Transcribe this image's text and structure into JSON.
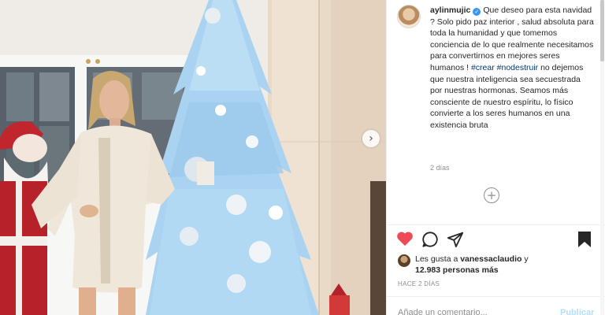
{
  "post": {
    "username": "aylinmujic",
    "verified_icon": "verified-badge-icon",
    "caption_main": "Que deseo para esta navidad ? Solo pido paz interior , salud absoluta para toda la humanidad y que tomemos conciencia de lo que realmente necesitamos para convertirnos en mejores seres humanos ! ",
    "hashtag_1": "#crear",
    "hashtag_2": "#nodestruir",
    "caption_end": " no dejemos que nuestra inteligencia sea secuestrada por nuestras hormonas. Seamos más consciente de nuestro espíritu, lo físico convierte a los seres humanos en una existencia bruta",
    "time_ago": "2 días",
    "add_comment_glyph": "+"
  },
  "actions": {
    "like_icon": "heart-icon",
    "comment_icon": "comment-icon",
    "share_icon": "share-icon",
    "save_icon": "bookmark-icon"
  },
  "likes": {
    "prefix": "Les gusta a ",
    "user": "vanessaclaudio",
    "middle": " y",
    "count": "12.983 personas más"
  },
  "date_label": "HACE 2 DÍAS",
  "comment": {
    "placeholder": "Añade un comentario...",
    "publish_label": "Publicar"
  },
  "carousel": {
    "next_glyph": "›"
  },
  "colors": {
    "heart": "#ed4956",
    "link": "#00376b",
    "verified": "#3897f0",
    "publish_disabled": "#b2dffc"
  }
}
